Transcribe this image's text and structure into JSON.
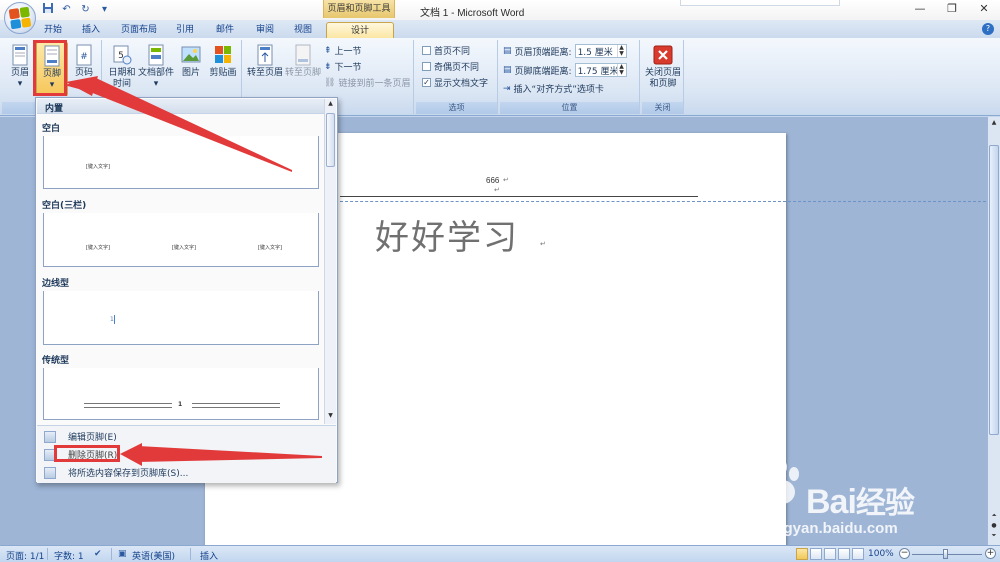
{
  "window": {
    "title": "文档 1 - Microsoft Word",
    "contextual_tab_group": "页眉和页脚工具",
    "controls": [
      "—",
      "❐",
      "✕"
    ]
  },
  "qat": [
    "save",
    "undo",
    "redo",
    "customize"
  ],
  "tabs": [
    {
      "label": "开始"
    },
    {
      "label": "插入"
    },
    {
      "label": "页面布局"
    },
    {
      "label": "引用"
    },
    {
      "label": "邮件"
    },
    {
      "label": "审阅"
    },
    {
      "label": "视图"
    },
    {
      "label": "设计",
      "active": true
    }
  ],
  "ribbon": {
    "header_footer_group": {
      "header": "页眉",
      "footer": "页脚",
      "page_number": "页码",
      "label_partial": "页"
    },
    "insert_group": {
      "date_time_1": "日期和",
      "date_time_2": "时间",
      "quick_parts": "文档部件",
      "picture": "图片",
      "clip_art": "剪贴画"
    },
    "navigation_group": {
      "goto_header": "转至页眉",
      "goto_footer": "转至页脚",
      "prev_section": "上一节",
      "next_section": "下一节",
      "link_to_prev": "链接到前一条页眉"
    },
    "options_group": {
      "label": "选项",
      "different_first": "首页不同",
      "different_odd_even": "奇偶页不同",
      "show_doc_text": "显示文档文字",
      "different_first_checked": false,
      "different_odd_even_checked": false,
      "show_doc_text_checked": true
    },
    "position_group": {
      "label": "位置",
      "header_from_top_label": "页眉顶端距离:",
      "header_from_top_value": "1.5 厘米",
      "footer_from_bottom_label": "页脚底端距离:",
      "footer_from_bottom_value": "1.75 厘米",
      "insert_alignment_tab": "插入“对齐方式”选项卡"
    },
    "close_group": {
      "label": "关闭",
      "close_1": "关闭页眉",
      "close_2": "和页脚"
    }
  },
  "dropdown": {
    "header": "内置",
    "categories": [
      {
        "name": "空白",
        "placeholders": [
          "[键入文字]"
        ]
      },
      {
        "name": "空白(三栏)",
        "placeholders": [
          "[键入文字]",
          "[键入文字]",
          "[键入文字]"
        ]
      },
      {
        "name": "边线型",
        "placeholders": [
          "1"
        ]
      },
      {
        "name": "传统型",
        "placeholders": [
          "1"
        ]
      }
    ],
    "menu_items": [
      {
        "label": "编辑页脚(E)"
      },
      {
        "label": "删除页脚(R)"
      },
      {
        "label": "将所选内容保存到页脚库(S)..."
      }
    ]
  },
  "document": {
    "header_text": "666",
    "body_text": "好好学习"
  },
  "statusbar": {
    "page": "页面: 1/1",
    "words": "字数: 1",
    "language": "英语(美国)",
    "mode": "插入",
    "zoom": "100%",
    "zoom_level": 1.0
  },
  "watermark": {
    "brand": "Bai",
    "brand_cn": "经验",
    "url": "jingyan.baidu.com"
  },
  "colors": {
    "annotation_red": "#e23a3a",
    "contextual_tab": "#f1c85a",
    "ribbon_bg": "#dbe6f4"
  }
}
